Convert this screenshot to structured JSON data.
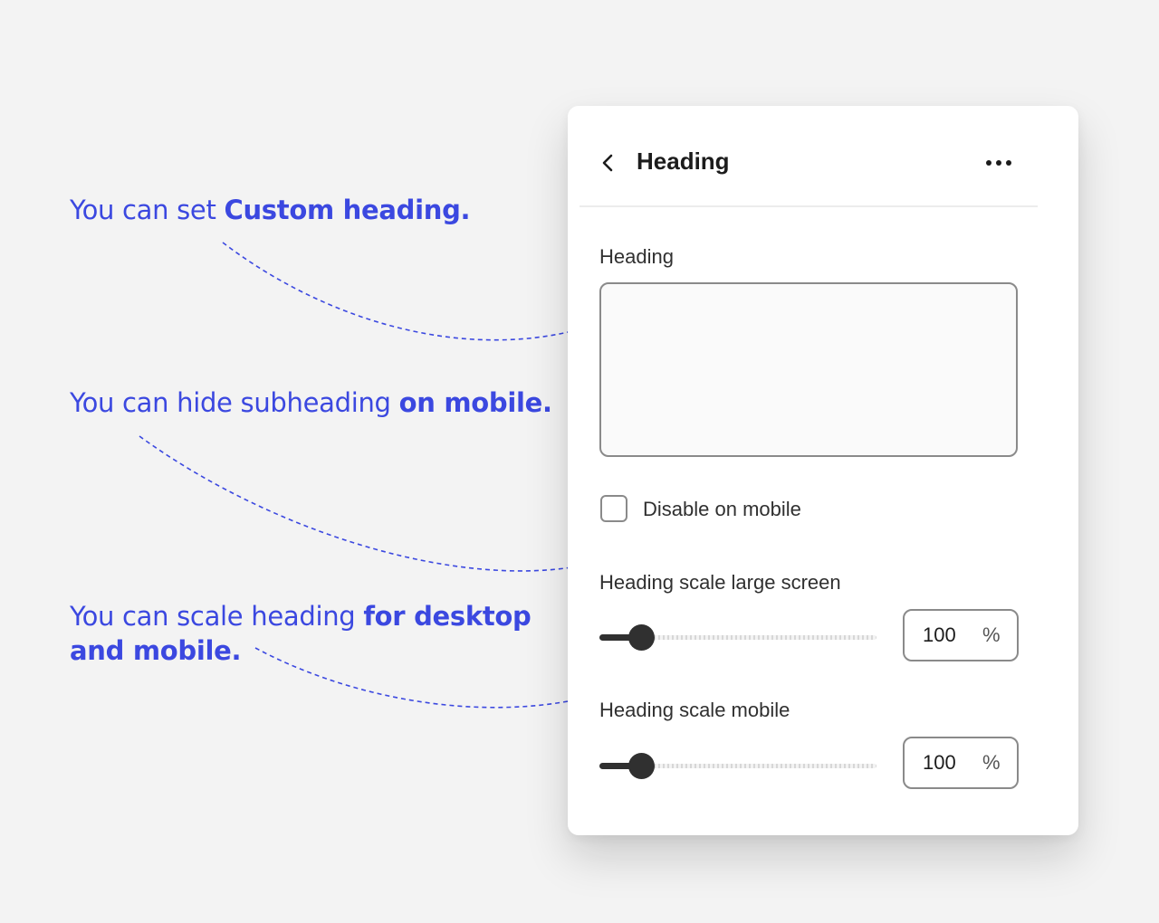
{
  "annotations": {
    "custom_heading": {
      "text": "You can set ",
      "bold": "Custom heading."
    },
    "hide_subheading": {
      "text": "You can hide subheading ",
      "bold": "on mobile."
    },
    "scale_heading": {
      "text": "You can scale heading ",
      "bold_line1": "for desktop",
      "bold_line2": "and mobile."
    }
  },
  "panel": {
    "title": "Heading",
    "back_icon": "chevron-left-icon",
    "more_icon": "more-horizontal-icon",
    "heading_field": {
      "label": "Heading",
      "value": "",
      "placeholder": ""
    },
    "disable_mobile": {
      "label": "Disable on mobile",
      "checked": false
    },
    "scale_large": {
      "label": "Heading scale large screen",
      "value": "100",
      "unit": "%"
    },
    "scale_mobile": {
      "label": "Heading scale mobile",
      "value": "100",
      "unit": "%"
    }
  },
  "colors": {
    "accent": "#3b48e0",
    "control": "#303030",
    "border": "#8a8a8a",
    "background": "#f3f3f3"
  }
}
